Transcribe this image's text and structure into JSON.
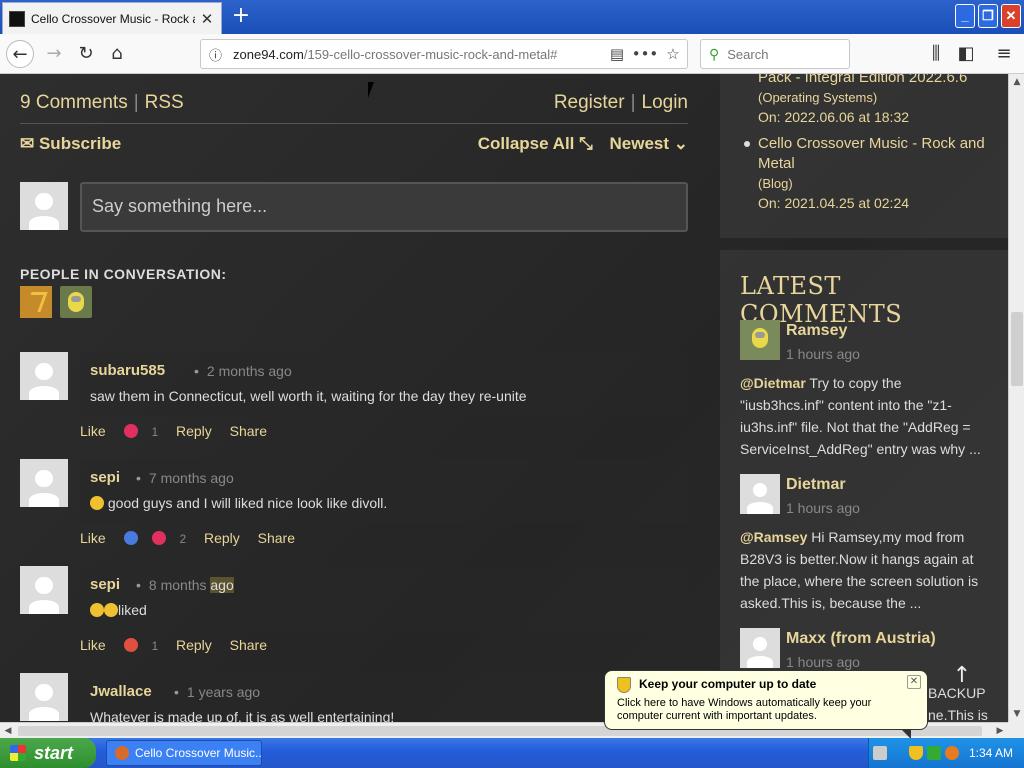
{
  "browser": {
    "tab_title": "Cello Crossover Music - Rock and Metal",
    "new_tab": "+",
    "url_host": "zone94.com",
    "url_path": "/159-cello-crossover-music-rock-and-metal#",
    "search_placeholder": "Search"
  },
  "comments_header": {
    "count_label": "9 Comments",
    "rss": "RSS",
    "register": "Register",
    "login": "Login",
    "subscribe": "Subscribe",
    "collapse_all": "Collapse All",
    "sort": "Newest",
    "compose_placeholder": "Say something here...",
    "people_title": "PEOPLE IN CONVERSATION:"
  },
  "comments": [
    {
      "author": "subaru585",
      "time": "2 months ago",
      "text": "saw them in Connecticut, well worth it, waiting for the day they re-unite",
      "like": "Like",
      "count": "1",
      "reply": "Reply",
      "share": "Share"
    },
    {
      "author": "sepi",
      "time": "7 months ago",
      "text": "good guys and I will liked nice look like divoll.",
      "like": "Like",
      "count": "2",
      "reply": "Reply",
      "share": "Share"
    },
    {
      "author": "sepi",
      "time_a": "8 months",
      "time_b": "ago",
      "text": "liked",
      "like": "Like",
      "count": "1",
      "reply": "Reply",
      "share": "Share"
    },
    {
      "author": "Jwallace",
      "time": "1 years ago",
      "text": "Whatever is made up of, it is as well entertaining!"
    }
  ],
  "sidebar": {
    "recent": [
      {
        "title": "Pack - Integral Edition 2022.6.6",
        "category": "(Operating Systems)",
        "date": "On: 2022.06.06 at 18:32"
      },
      {
        "title_1": "Cello Crossover Music - Rock and",
        "title_2": "Metal",
        "category": "(Blog)",
        "date": "On: 2021.04.25 at 02:24"
      }
    ],
    "latest_title": "LATEST COMMENTS",
    "latest": [
      {
        "name": "Ramsey",
        "time": "1 hours ago",
        "mention": "@Dietmar",
        "text": " Try to copy the \"iusb3hcs.inf\" content into the \"z1-iu3hs.inf\" file. Not that the \"AddReg = ServiceInst_AddReg\" entry was why ..."
      },
      {
        "name": "Dietmar",
        "time": "1 hours ago",
        "mention": "@Ramsey",
        "text": " Hi Ramsey,my mod from B28V3 is better.Now it hangs again at the place, where the screen solution is asked.This is, because the ..."
      },
      {
        "name": "Maxx (from Austria)",
        "time": "1 hours ago",
        "partial_1": "BACKUP",
        "partial_2": "ne.This is"
      }
    ]
  },
  "balloon": {
    "title": "Keep your computer up to date",
    "text": "Click here to have Windows automatically keep your computer current with important updates."
  },
  "taskbar": {
    "start": "start",
    "task": "Cello Crossover Music...",
    "clock": "1:34 AM"
  }
}
